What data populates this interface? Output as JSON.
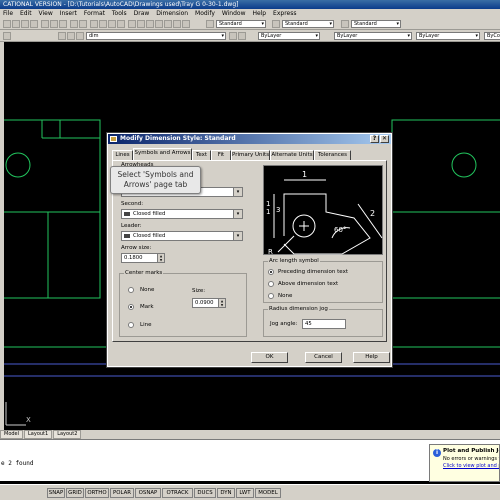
{
  "window": {
    "title": "CATIONAL VERSION - [D:\\Tutorials\\AutoCAD\\Drawings used\\Tray G 0-30-1.dwg]"
  },
  "menu": [
    "File",
    "Edit",
    "View",
    "Insert",
    "Format",
    "Tools",
    "Draw",
    "Dimension",
    "Modify",
    "Window",
    "Help",
    "Express"
  ],
  "toolbar": {
    "style_combo_1": "Standard",
    "style_combo_2": "Standard",
    "style_combo_3": "Standard",
    "layer_combo": "dim",
    "color_combo": "ByLayer",
    "linetype_combo": "ByLayer",
    "lineweight_combo": "ByLayer",
    "plotstyle_combo": "ByColor"
  },
  "dialog": {
    "title": "Modify Dimension Style: Standard",
    "help_glyph": "?",
    "close_glyph": "✕",
    "tabs": [
      "Lines",
      "Symbols and Arrows",
      "Text",
      "Fit",
      "Primary Units",
      "Alternate Units",
      "Tolerances"
    ],
    "active_tab": "Symbols and Arrows",
    "arrowheads_label": "Arrowheads",
    "first_value": "Closed filled",
    "second_label": "Second:",
    "second_value": "Closed filled",
    "leader_label": "Leader:",
    "leader_value": "Closed filled",
    "arrow_size_label": "Arrow size:",
    "arrow_size_value": "0.1800",
    "center_marks_label": "Center marks",
    "none_label": "None",
    "mark_label": "Mark",
    "line_label": "Line",
    "size_label": "Size:",
    "size_value": "0.0900",
    "arc_length_label": "Arc length symbol",
    "arc_opt1": "Preceding dimension text",
    "arc_opt2": "Above dimension text",
    "arc_opt3": "None",
    "radius_jog_label": "Radius dimension jog",
    "jog_angle_label": "Jog angle:",
    "jog_angle_value": "45",
    "preview": {
      "dim_top": "1",
      "dim_left_a": "1",
      "dim_left_b": "1",
      "dim_left_c": "3",
      "dim_right": "2",
      "angle": "60°",
      "radius": "R"
    },
    "ok": "OK",
    "cancel": "Cancel",
    "help": "Help"
  },
  "tooltip": {
    "line1": "Select 'Symbols and",
    "line2": "Arrows' page tab"
  },
  "ucs_label": "X",
  "layout_tabs": [
    "Model",
    "Layout1",
    "Layout2"
  ],
  "command_line": "e 2 found",
  "status_buttons": [
    "SNAP",
    "GRID",
    "ORTHO",
    "POLAR",
    "OSNAP",
    "OTRACK",
    "DUCS",
    "DYN",
    "LWT",
    "MODEL"
  ],
  "balloon": {
    "title": "Plot and Publish Jo",
    "line1": "No errors or warnings foun",
    "link": "Click to view plot and publ"
  },
  "colors": {
    "drawing_line": "#22c55e",
    "drawing_background": "#000000",
    "dialog_face": "#d4d0c8",
    "title_bar": "#0a246a"
  }
}
